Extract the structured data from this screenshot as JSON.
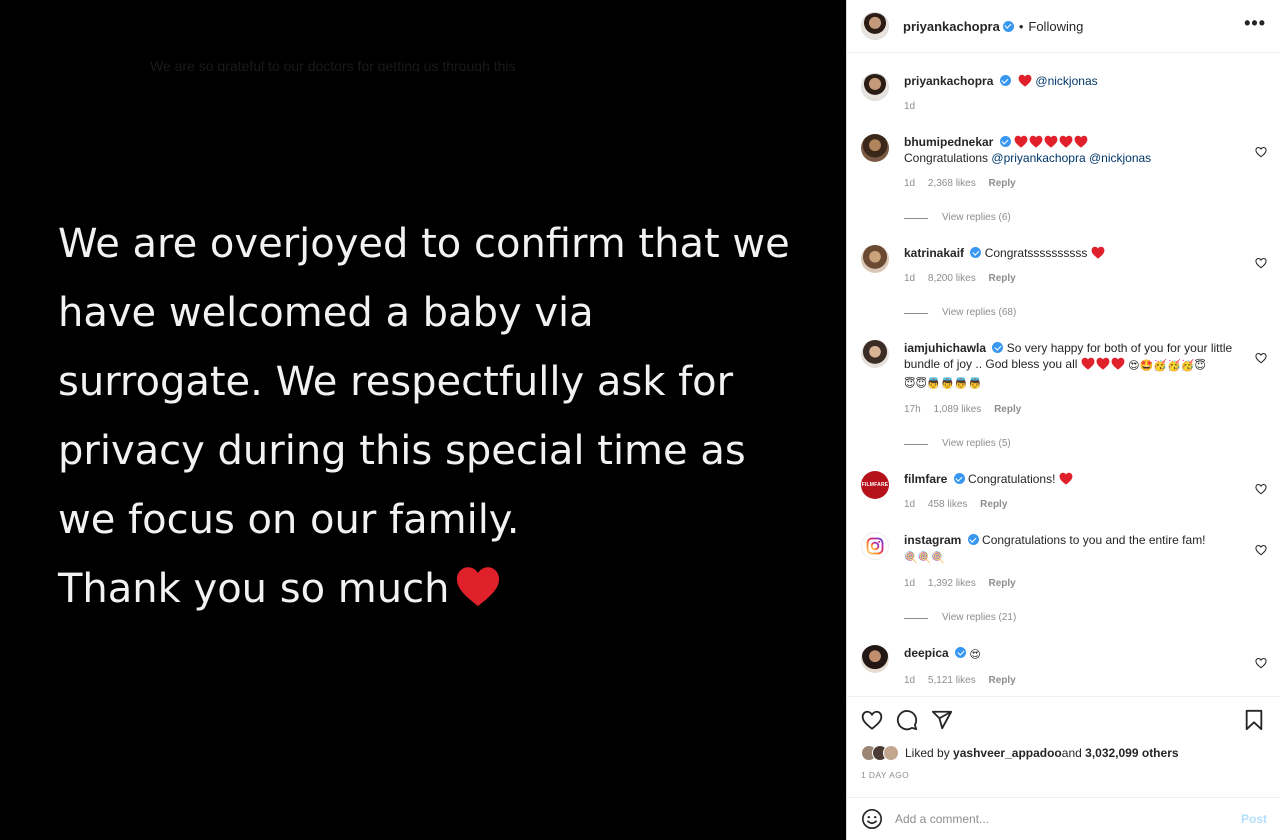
{
  "media": {
    "faint_text": "We are so grateful to our doctors for getting us through this",
    "lines": [
      "We are overjoyed to confirm that we",
      "have welcomed a baby via",
      "surrogate. We respectfully ask for",
      "privacy during this special time as",
      "we focus on our family.",
      "Thank you so much"
    ]
  },
  "header": {
    "username": "priyankachopra",
    "separator": "•",
    "follow_status": "Following",
    "more_label": "•••"
  },
  "caption": {
    "username": "priyankachopra",
    "mention": "@nickjonas",
    "time": "1d"
  },
  "comments": [
    {
      "username": "bhumipednekar",
      "text_prefix": "Congratulations ",
      "mention1": "@priyankachopra",
      "mention2": "@nickjonas",
      "time": "1d",
      "likes": "2,368 likes",
      "reply": "Reply",
      "view_replies": "View replies (6)"
    },
    {
      "username": "katrinakaif",
      "text": "Congratssssssssss",
      "time": "1d",
      "likes": "8,200 likes",
      "reply": "Reply",
      "view_replies": "View replies (68)"
    },
    {
      "username": "iamjuhichawla",
      "text": "So very happy for both of you for your little bundle of joy .. God bless you all",
      "emojis_line1": "😍🤩🥳🥳🥳😇",
      "emojis_line2": "😇😇👼👼👼👼",
      "time": "17h",
      "likes": "1,089 likes",
      "reply": "Reply",
      "view_replies": "View replies (5)"
    },
    {
      "username": "filmfare",
      "text": "Congratulations!",
      "avatar_text": "FILMFARE",
      "time": "1d",
      "likes": "458 likes",
      "reply": "Reply"
    },
    {
      "username": "instagram",
      "text": "Congratulations to you and the entire fam!",
      "emojis": "🍭🍭🍭",
      "time": "1d",
      "likes": "1,392 likes",
      "reply": "Reply",
      "view_replies": "View replies (21)"
    },
    {
      "username": "deepica",
      "emoji": "😍",
      "time": "1d",
      "likes": "5,121 likes",
      "reply": "Reply"
    }
  ],
  "likes_summary": {
    "prefix": "Liked by ",
    "user": "yashveer_appadoo",
    "middle": " and ",
    "others": "3,032,099 others"
  },
  "time_ago": "1 DAY AGO",
  "add_comment": {
    "placeholder": "Add a comment...",
    "post_label": "Post"
  },
  "colors": {
    "verified": "#3897f0",
    "heart": "#ed4956",
    "mention": "#00376b",
    "muted": "#8e8e8e",
    "post_disabled": "#b2dffc"
  }
}
